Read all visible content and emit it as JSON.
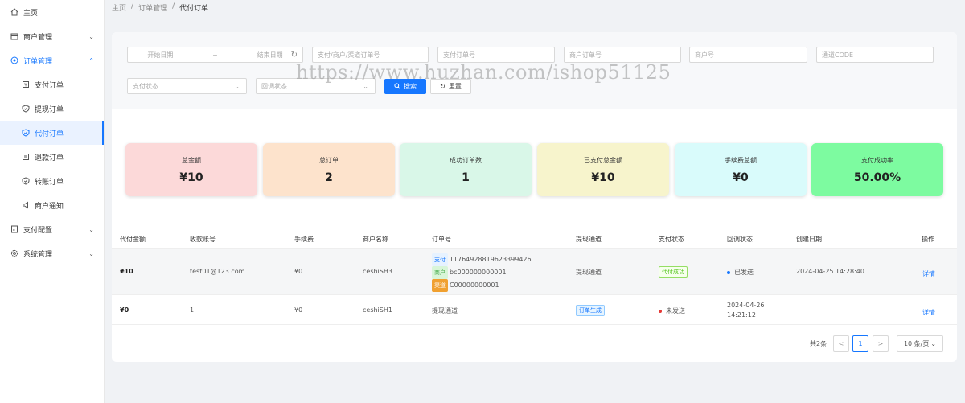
{
  "breadcrumb": {
    "home": "主页",
    "sep": "/",
    "level2": "订单管理",
    "current": "代付订单"
  },
  "sidebar": {
    "items": [
      {
        "label": "主页",
        "icon": "home-icon"
      },
      {
        "label": "商户管理",
        "icon": "store-icon"
      },
      {
        "label": "订单管理",
        "icon": "order-icon"
      },
      {
        "label": "支付订单",
        "icon": "pay-order-icon"
      },
      {
        "label": "提现订单",
        "icon": "withdraw-icon"
      },
      {
        "label": "代付订单",
        "icon": "payout-icon"
      },
      {
        "label": "退款订单",
        "icon": "refund-icon"
      },
      {
        "label": "转账订单",
        "icon": "transfer-icon"
      },
      {
        "label": "商户通知",
        "icon": "notify-icon"
      },
      {
        "label": "支付配置",
        "icon": "pay-config-icon"
      },
      {
        "label": "系统管理",
        "icon": "settings-icon"
      }
    ]
  },
  "filters": {
    "start_date": "开始日期",
    "date_sep": "~",
    "end_date": "结束日期",
    "order_no": "支付/商户/渠道订单号",
    "pay_order_no": "支付订单号",
    "mch_order_no": "商户订单号",
    "mch_no": "商户号",
    "channel_code": "通道CODE",
    "pay_state": "支付状态",
    "callback_state": "回调状态",
    "search": "搜索",
    "reset": "重置"
  },
  "watermark": "https://www.huzhan.com/ishop51125",
  "stats": [
    {
      "label": "总金额",
      "value": "¥10",
      "color": "#fcd9d9"
    },
    {
      "label": "总订单",
      "value": "2",
      "color": "#fde3cc"
    },
    {
      "label": "成功订单数",
      "value": "1",
      "color": "#d9f7e8"
    },
    {
      "label": "已支付总金额",
      "value": "¥10",
      "color": "#f7f4cc"
    },
    {
      "label": "手续费总额",
      "value": "¥0",
      "color": "#d9fbfb"
    },
    {
      "label": "支付成功率",
      "value": "50.00%",
      "color": "#7dfba0"
    }
  ],
  "table": {
    "headers": [
      "代付金额",
      "收款账号",
      "手续费",
      "商户名称",
      "订单号",
      "提现通道",
      "支付状态",
      "回调状态",
      "创建日期",
      "操作"
    ],
    "rows": [
      {
        "amount": "¥10",
        "account": "test01@123.com",
        "fee": "¥0",
        "mch_name": "ceshiSH3",
        "tag_pay": "支付",
        "pay_no": "T1764928819623399426",
        "tag_mch": "商户",
        "mch_no": "bc000000000001",
        "tag_ch": "渠道",
        "ch_no": "C00000000001",
        "channel": "提现通道",
        "pay_state": "代付成功",
        "callback": "已发送",
        "created": "2024-04-25 14:28:40",
        "action": "详情"
      },
      {
        "amount": "¥0",
        "account": "1",
        "fee": "¥0",
        "mch_name": "ceshiSH1",
        "order_no": "提现通道",
        "channel": "订单生成",
        "pay_state": "未发送",
        "created_date": "2024-04-26",
        "created_time": "14:21:12",
        "action": "详情"
      }
    ]
  },
  "pagination": {
    "total": "共2条",
    "prev": "<",
    "page": "1",
    "next": ">",
    "size": "10 条/页"
  },
  "colors": {
    "accent": "#1677ff",
    "dot_sent": "#1677ff",
    "dot_unsent": "#e53935"
  }
}
